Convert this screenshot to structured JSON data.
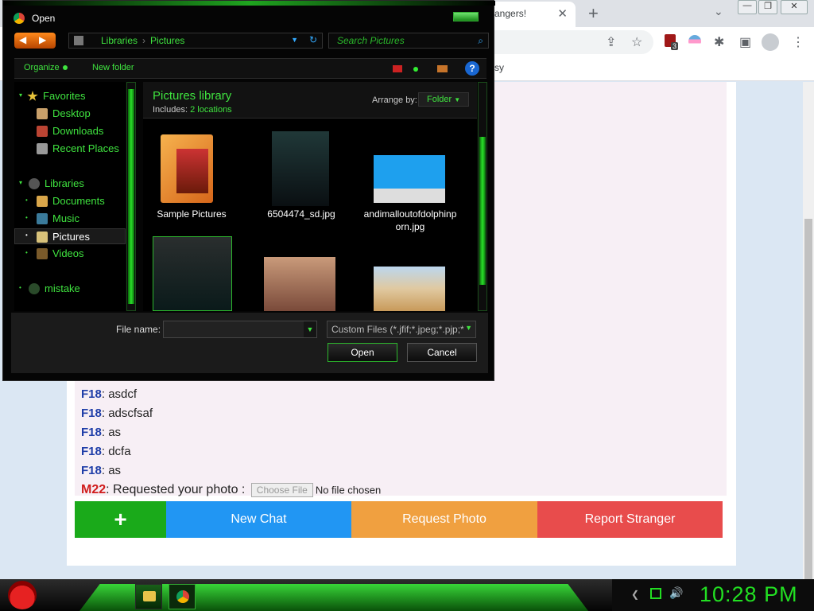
{
  "browser": {
    "tab_title": "angers!",
    "bookmark_text": "sy",
    "new_tab": "+",
    "tab_close": "✕",
    "tab_menu": "⌄",
    "window_controls": [
      "—",
      "❐",
      "✕"
    ],
    "extension_badge": "3"
  },
  "chat": {
    "messages": [
      {
        "user": "F18",
        "text": ": asdcf"
      },
      {
        "user": "F18",
        "text": ": adscfsaf"
      },
      {
        "user": "F18",
        "text": ": as"
      },
      {
        "user": "F18",
        "text": ": dcfa"
      },
      {
        "user": "F18",
        "text": ": as"
      }
    ],
    "request": {
      "user": "M22",
      "text": ": Requested your photo : ",
      "choose_file": "Choose File",
      "no_file": "No file chosen"
    },
    "buttons": {
      "plus": "+",
      "new_chat": "New Chat",
      "request_photo": "Request Photo",
      "report": "Report Stranger"
    },
    "colors": {
      "plus": "#1aaa1a",
      "new_chat": "#2196f3",
      "request_photo": "#f0a040",
      "report": "#e84c4c",
      "male": "#d01c1c",
      "female": "#1f3ea8"
    }
  },
  "dialog": {
    "title": "Open",
    "breadcrumb": [
      "Libraries",
      "Pictures"
    ],
    "search_placeholder": "Search Pictures",
    "organize": "Organize",
    "new_folder": "New folder",
    "help": "?",
    "tree": [
      {
        "label": "Favorites",
        "icon": "star-icon"
      },
      {
        "label": "Desktop",
        "icon": "desktop-icon"
      },
      {
        "label": "Downloads",
        "icon": "downloads-icon"
      },
      {
        "label": "Recent Places",
        "icon": "recent-places-icon"
      },
      {
        "label": "Libraries",
        "icon": "libraries-icon"
      },
      {
        "label": "Documents",
        "icon": "documents-icon"
      },
      {
        "label": "Music",
        "icon": "music-icon"
      },
      {
        "label": "Pictures",
        "icon": "pictures-icon"
      },
      {
        "label": "Videos",
        "icon": "videos-icon"
      },
      {
        "label": "mistake",
        "icon": "homegroup-icon"
      }
    ],
    "library_title": "Pictures library",
    "includes_label": "Includes:",
    "includes_value": "2 locations",
    "arrange_label": "Arrange by:",
    "arrange_value": "Folder",
    "files": [
      {
        "name": "Sample Pictures"
      },
      {
        "name": "6504474_sd.jpg"
      },
      {
        "name": "andimalloutofdolphinporn.jpg"
      }
    ],
    "file_name_label": "File name:",
    "file_name_value": "",
    "filter": "Custom Files (*.jfif;*.jpeg;*.pjp;*",
    "open": "Open",
    "cancel": "Cancel"
  },
  "taskbar": {
    "clock": "10:28 PM"
  }
}
